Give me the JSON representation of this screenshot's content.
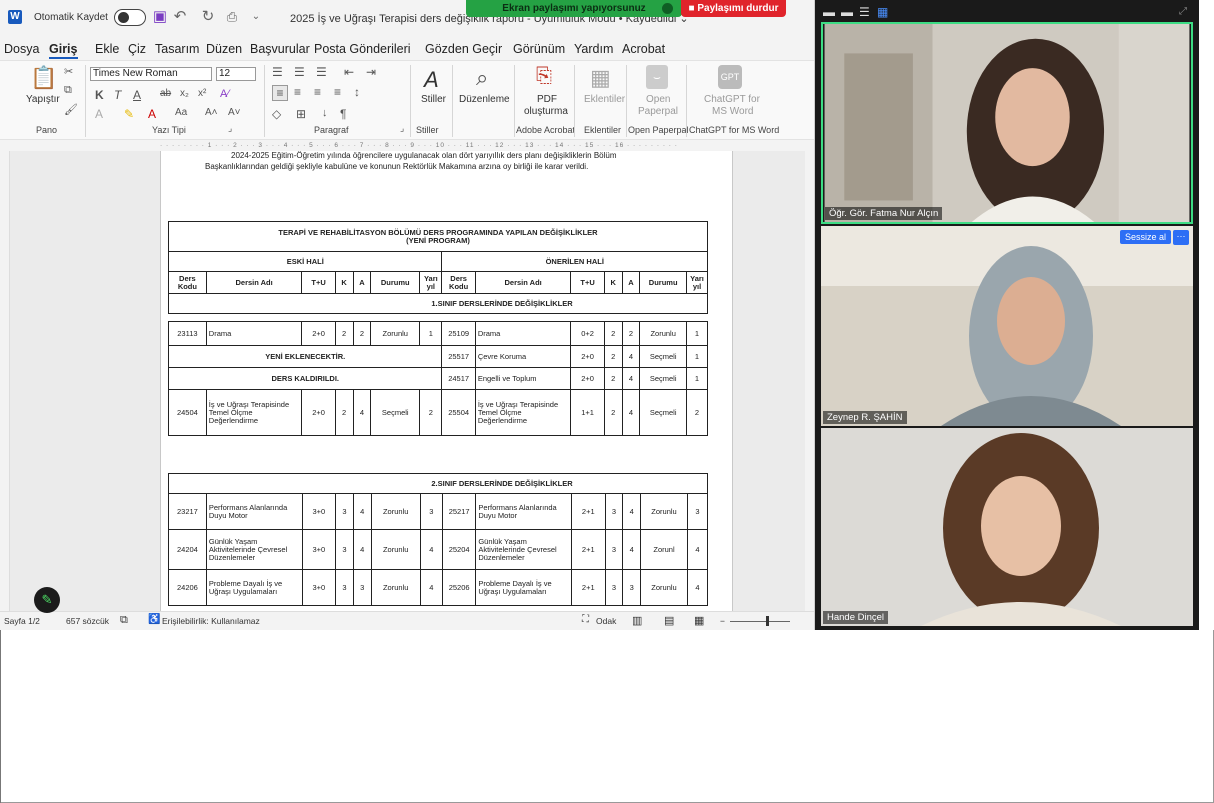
{
  "titlebar": {
    "autosave_label": "Otomatik Kaydet",
    "autosave_state": "Kapalı",
    "document_title": "2025 İş ve Uğraşı Terapisi ders değişiklik raporu - Uyumluluk Modu • Kaydedildi ⌄"
  },
  "share_banner": {
    "sharing_text": "Ekran paylaşımı yapıyorsunuz",
    "stop_label": "Paylaşımı durdur"
  },
  "menu": {
    "items": [
      "Dosya",
      "Giriş",
      "Ekle",
      "Çiz",
      "Tasarım",
      "Düzen",
      "Başvurular",
      "Posta Gönderileri",
      "Gözden Geçir",
      "Görünüm",
      "Yardım",
      "Acrobat"
    ]
  },
  "ribbon": {
    "paste_label": "Yapıştır",
    "font_name": "Times New Roman",
    "font_size": "12",
    "styles_label": "Stiller",
    "editing_label": "Düzenleme",
    "pdf_label_1": "PDF",
    "pdf_label_2": "oluşturma",
    "addins_label": "Eklentiler",
    "paperpal_label_1": "Open",
    "paperpal_label_2": "Paperpal",
    "chatgpt_label_1": "ChatGPT for",
    "chatgpt_label_2": "MS Word",
    "groups": {
      "clipboard": "Pano",
      "font": "Yazı Tipi",
      "paragraph": "Paragraf",
      "styles": "Stiller",
      "acrobat": "Adobe Acrobat",
      "addins": "Eklentiler",
      "paperpal": "Open Paperpal",
      "chatgpt": "ChatGPT for MS Word"
    }
  },
  "ruler": {
    "marks": "· · · · · · · · 1 · · · 2 · · · 3 · · · 4 · · · 5 · · · 6 · · · 7 · · · 8 · · · 9 · · · 10 · · · 11 · · · 12 · · · 13 · · · 14 · · · 15 · · · 16 · · · · · · · · ·"
  },
  "document": {
    "intro_line_1": "2024-2025 Eğitim-Öğretim yılında öğrencilere uygulanacak olan dört yarıyıllık ders planı değişikliklerin Bölüm",
    "intro_line_2": "Başkanlıklarından geldiği şekliyle kabulüne ve konunun Rektörlük Makamına arzına oy birliği ile karar verildi.",
    "table_title_1": "TERAPİ VE REHABİLİTASYON BÖLÜMÜ DERS PROGRAMINDA YAPILAN DEĞİŞİKLİKLER",
    "table_title_2": "(YENİ PROGRAM)",
    "old_header": "ESKİ HALİ",
    "new_header": "ÖNERİLEN HALİ",
    "columns": [
      "Ders Kodu",
      "Dersin Adı",
      "T+U",
      "K",
      "A",
      "Durumu",
      "Yarı yıl"
    ],
    "section1_title": "1.SINIF DERSLERİNDE DEĞİŞİKLİKLER",
    "section1_rows": [
      {
        "old": [
          "23113",
          "Drama",
          "2+0",
          "2",
          "2",
          "Zorunlu",
          "1"
        ],
        "new": [
          "25109",
          "Drama",
          "0+2",
          "2",
          "2",
          "Zorunlu",
          "1"
        ]
      },
      {
        "old_note": "YENİ EKLENECEKTİR.",
        "new": [
          "25517",
          "Çevre Koruma",
          "2+0",
          "2",
          "4",
          "Seçmeli",
          "1"
        ]
      },
      {
        "old_note": "DERS KALDIRILDI.",
        "new": [
          "24517",
          "Engelli ve Toplum",
          "2+0",
          "2",
          "4",
          "Seçmeli",
          "1"
        ]
      },
      {
        "old": [
          "24504",
          "İş ve Uğraşı Terapisinde Temel Ölçme Değerlendirme",
          "2+0",
          "2",
          "4",
          "Seçmeli",
          "2"
        ],
        "new": [
          "25504",
          "İş ve Uğraşı Terapisinde Temel Ölçme Değerlendirme",
          "1+1",
          "2",
          "4",
          "Seçmeli",
          "2"
        ]
      }
    ],
    "section2_title": "2.SINIF DERSLERİNDE DEĞİŞİKLİKLER",
    "section2_rows": [
      {
        "old": [
          "23217",
          "Performans Alanlarında Duyu Motor",
          "3+0",
          "3",
          "4",
          "Zorunlu",
          "3"
        ],
        "new": [
          "25217",
          "Performans Alanlarında Duyu Motor",
          "2+1",
          "3",
          "4",
          "Zorunlu",
          "3"
        ]
      },
      {
        "old": [
          "24204",
          "Günlük Yaşam Aktivitelerinde Çevresel Düzenlemeler",
          "3+0",
          "3",
          "4",
          "Zorunlu",
          "4"
        ],
        "new": [
          "25204",
          "Günlük Yaşam Aktivitelerinde Çevresel Düzenlemeler",
          "2+1",
          "3",
          "4",
          "Zorunl",
          "4"
        ]
      },
      {
        "old": [
          "24206",
          "Probleme Dayalı İş ve Uğraşı Uygulamaları",
          "3+0",
          "3",
          "3",
          "Zorunlu",
          "4"
        ],
        "new": [
          "25206",
          "Probleme Dayalı İş ve Uğraşı Uygulamaları",
          "2+1",
          "3",
          "3",
          "Zorunlu",
          "4"
        ]
      }
    ]
  },
  "statusbar": {
    "page": "Sayfa 1/2",
    "words": "657 sözcük",
    "accessibility": "Erişilebilirlik: Kullanılamaz",
    "focus": "Odak"
  },
  "participants": [
    {
      "name": "Öğr. Gör. Fatma Nur Alçın",
      "active_speaker": true
    },
    {
      "name": "Zeynep R. ŞAHİN"
    },
    {
      "name": "Hande Dinçel"
    }
  ],
  "video_controls": {
    "mute_label": "Sessize al",
    "more_label": "···"
  },
  "colors": {
    "word_blue": "#185abd",
    "share_green": "#25a244",
    "stop_red": "#e0242b",
    "speaker_border": "#3ddc84",
    "zoom_blue": "#2d6ef5"
  }
}
